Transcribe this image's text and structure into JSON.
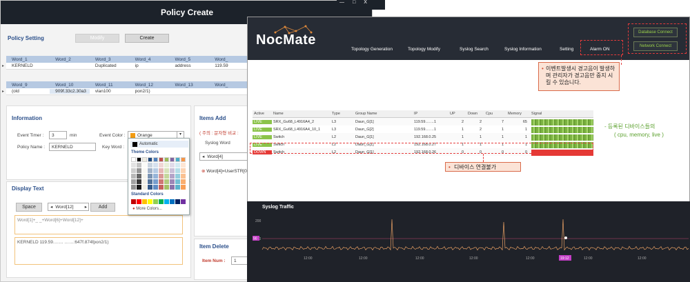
{
  "policy": {
    "title": "Policy Create",
    "setting_title": "Policy Setting",
    "modify_label": "Modify",
    "create_label": "Create",
    "grid1_headers": [
      "Word_1",
      "Word_2",
      "Word_3",
      "Word_4",
      "Word_5",
      "Word_"
    ],
    "grid1_row": [
      "KERNELD",
      "",
      "Duplicated",
      "ip",
      "address",
      "119.59"
    ],
    "grid2_headers": [
      "Word_9",
      "Word_10",
      "Word_11",
      "Word_12",
      "Word_13",
      "Word_"
    ],
    "grid2_row": [
      "(old",
      "909f.33c2.30a3",
      "vlan100",
      "pon2/1)",
      "",
      ""
    ],
    "info_title": "Information",
    "event_timer_label": "Event Timer :",
    "event_timer_value": "3",
    "event_timer_unit": "min",
    "event_color_label": "Event Color :",
    "event_color_value": "Orange",
    "policy_name_label": "Policy Name :",
    "policy_name_value": "KERNELD",
    "key_word_label": "Key Word :",
    "picker_auto": "Automatic",
    "picker_theme": "Theme Colors",
    "picker_standard": "Standard Colors",
    "picker_more": "More Colors...",
    "items_add_title": "Items Add",
    "items_note": "( 주의 :   문자형 비교 :",
    "syslog_word_label": "Syslog Word",
    "word_select": "Word[4]",
    "error_text": "Word[4]=UserSTR[0]",
    "display_title": "Display Text",
    "space_label": "Space",
    "word12_select": "Word[12]",
    "add_label": "Add",
    "display_formula": "Word[1]+_ _+Word[6]+Word[12]+",
    "display_preview": "KERNELD  119.59.……  ……:647f.874fpon2/1)",
    "item_delete_title": "Item Delete",
    "item_num_label": "Item Num :",
    "item_num_value": "1"
  },
  "noc": {
    "window_controls": [
      "—",
      "□",
      "X"
    ],
    "logo": "NocMate",
    "menu": [
      "Topology Generation",
      "Topology Modify",
      "Syslog Search",
      "Syslog Information",
      "Setting",
      "Alarm ON"
    ],
    "database_connect": "Database Connect",
    "network_connect": "Network Connect",
    "callout_alarm": "이벤트발생시 경고음이 발생하며 관리자가 경고음만 중지 시킬 수 있습니다.",
    "callout_device": "디바이스 연결불가",
    "note_line1": "- 등록된 디바이스들의",
    "note_line2": "( cpu, memory, live )",
    "table_headers": [
      "Active",
      "Name",
      "Type",
      "Group Name",
      "IP",
      "UP",
      "Down",
      "Cpu",
      "Memory",
      "Signal"
    ],
    "rows": [
      {
        "active": "LIVE",
        "name": "SRX_Gu68_L4916A4_2",
        "type": "L3",
        "group": "Daun_G[1]",
        "ip": "119.59.……1",
        "up": "2",
        "down": "2",
        "cpu": "7",
        "mem": "65"
      },
      {
        "active": "LIVE",
        "name": "SRX_Gu68_L4916A4_10_1",
        "type": "L3",
        "group": "Daun_G[2]",
        "ip": "119.59.……1",
        "up": "1",
        "down": "2",
        "cpu": "1",
        "mem": "1"
      },
      {
        "active": "LIVE",
        "name": "Switch",
        "type": "L2",
        "group": "Daun_G[1]",
        "ip": "192.168.0.25",
        "up": "1",
        "down": "1",
        "cpu": "1",
        "mem": "1"
      },
      {
        "active": "LIVE",
        "name": "Switch",
        "type": "L2",
        "group": "Daun_G[1]",
        "ip": "192.168.0.27",
        "up": "1",
        "down": "1",
        "cpu": "1",
        "mem": "1"
      },
      {
        "active": "DOWN",
        "name": "Switch",
        "type": "L2",
        "group": "Daun_G[1]",
        "ip": "192.168.0.26",
        "up": "0",
        "down": "0",
        "cpu": "0",
        "mem": "0"
      }
    ],
    "traffic_title": "Syslog Traffic",
    "traffic_y_ticks": [
      "200",
      "100"
    ],
    "traffic_x_ticks": [
      "12:00",
      "12:00",
      "12:00",
      "12:00",
      "12:00",
      "19:12",
      "12:00",
      "12:00"
    ],
    "traffic_marker": "90"
  }
}
